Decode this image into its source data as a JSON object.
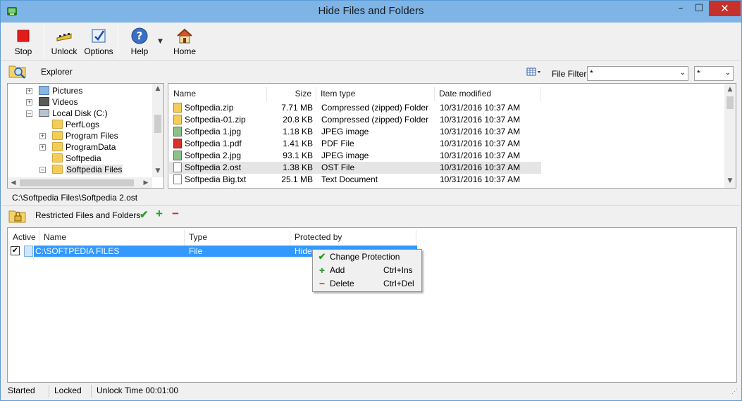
{
  "window": {
    "title": "Hide Files and Folders",
    "controls": {
      "minimize": "–",
      "maximize": "☐",
      "close": "✕"
    }
  },
  "toolbar": {
    "stop": "Stop",
    "unlock": "Unlock",
    "options": "Options",
    "help": "Help",
    "home": "Home"
  },
  "explorer": {
    "header": "Explorer",
    "file_filter_label": "File Filter",
    "file_filter_value": "*",
    "file_filter_value2": "*",
    "tree": [
      {
        "label": "Pictures",
        "expander": "+"
      },
      {
        "label": "Videos",
        "expander": "+"
      },
      {
        "label": "Local Disk (C:)",
        "expander": "–"
      },
      {
        "label": "PerfLogs",
        "expander": ""
      },
      {
        "label": "Program Files",
        "expander": "+"
      },
      {
        "label": "ProgramData",
        "expander": "+"
      },
      {
        "label": "Softpedia",
        "expander": ""
      },
      {
        "label": "Softpedia Files",
        "expander": "–"
      }
    ],
    "columns": {
      "name": "Name",
      "size": "Size",
      "type": "Item type",
      "modified": "Date modified"
    },
    "files": [
      {
        "name": "Softpedia.zip",
        "size": "7.71 MB",
        "type": "Compressed (zipped) Folder",
        "modified": "10/31/2016 10:37 AM",
        "icon": "zip-icon"
      },
      {
        "name": "Softpedia-01.zip",
        "size": "20.8 KB",
        "type": "Compressed (zipped) Folder",
        "modified": "10/31/2016 10:37 AM",
        "icon": "zip-icon"
      },
      {
        "name": "Softpedia 1.jpg",
        "size": "1.18 KB",
        "type": "JPEG image",
        "modified": "10/31/2016 10:37 AM",
        "icon": "image-icon"
      },
      {
        "name": "Softpedia 1.pdf",
        "size": "1.41 KB",
        "type": "PDF File",
        "modified": "10/31/2016 10:37 AM",
        "icon": "pdf-icon"
      },
      {
        "name": "Softpedia 2.jpg",
        "size": "93.1 KB",
        "type": "JPEG image",
        "modified": "10/31/2016 10:37 AM",
        "icon": "image-icon"
      },
      {
        "name": "Softpedia 2.ost",
        "size": "1.38 KB",
        "type": "OST File",
        "modified": "10/31/2016 10:37 AM",
        "icon": "file-icon"
      },
      {
        "name": "Softpedia Big.txt",
        "size": "25.1 MB",
        "type": "Text Document",
        "modified": "10/31/2016 10:37 AM",
        "icon": "text-icon"
      }
    ],
    "selected_path": "C:\\Softpedia Files\\Softpedia 2.ost"
  },
  "restricted": {
    "header": "Restricted Files and Folders",
    "columns": {
      "active": "Active",
      "name": "Name",
      "type": "Type",
      "protected_by": "Protected by"
    },
    "rows": [
      {
        "name": "C:\\SOFTPEDIA FILES",
        "type": "File",
        "protected_by": "Hide",
        "active": true
      }
    ]
  },
  "context_menu": {
    "items": [
      {
        "label": "Change Protection",
        "shortcut": "",
        "icon": "check-icon"
      },
      {
        "label": "Add",
        "shortcut": "Ctrl+Ins",
        "icon": "plus-icon"
      },
      {
        "label": "Delete",
        "shortcut": "Ctrl+Del",
        "icon": "minus-icon"
      }
    ]
  },
  "status": {
    "state": "Started",
    "lock": "Locked",
    "unlock_time": "Unlock Time 00:01:00"
  },
  "colors": {
    "titlebar": "#7eb4e6",
    "close": "#c7312b",
    "selection": "#3399ff",
    "check": "#2a9d2a",
    "minus": "#d12a2a"
  }
}
